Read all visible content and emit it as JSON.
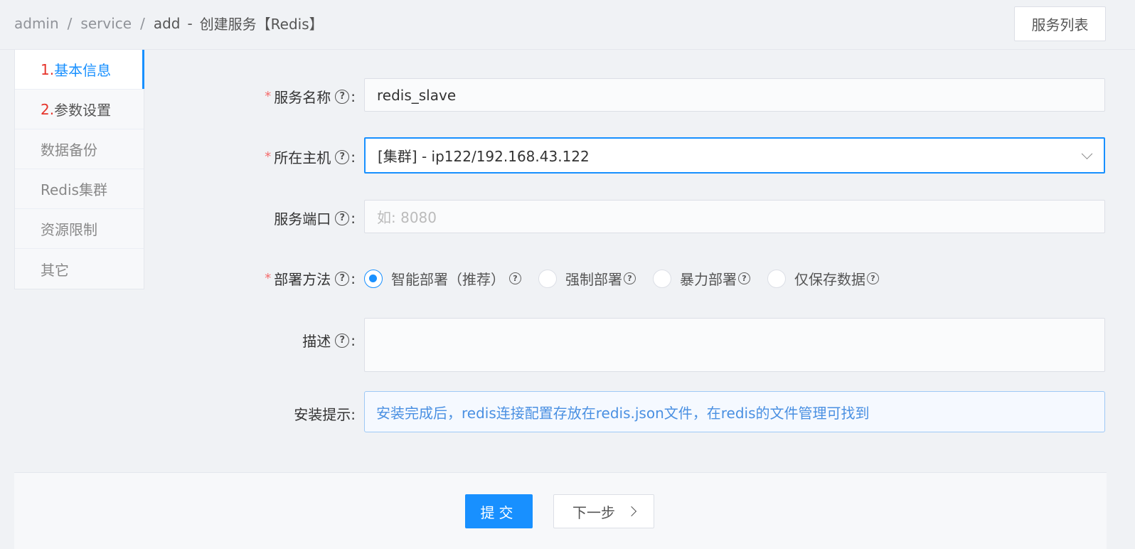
{
  "breadcrumb": {
    "items": [
      "admin",
      "service",
      "add"
    ],
    "separator": "/",
    "dash": "-",
    "page_title": "创建服务【Redis】"
  },
  "header": {
    "service_list_button": "服务列表"
  },
  "sidenav": {
    "items": [
      {
        "num": "1.",
        "label": "基本信息"
      },
      {
        "num": "2.",
        "label": "参数设置"
      },
      {
        "label": "数据备份"
      },
      {
        "label": "Redis集群"
      },
      {
        "label": "资源限制"
      },
      {
        "label": "其它"
      }
    ]
  },
  "form": {
    "required_mark": "*",
    "help_glyph": "?",
    "colon": ":",
    "service_name": {
      "label": "服务名称",
      "value": "redis_slave"
    },
    "host": {
      "label": "所在主机",
      "value": "[集群] - ip122/192.168.43.122"
    },
    "port": {
      "label": "服务端口",
      "placeholder": "如: 8080"
    },
    "deploy": {
      "label": "部署方法",
      "options": [
        "智能部署（推荐）",
        "强制部署",
        "暴力部署",
        "仅保存数据"
      ],
      "selected": "智能部署（推荐）"
    },
    "description": {
      "label": "描述",
      "value": ""
    },
    "install_hint": {
      "label": "安装提示:",
      "text": "安装完成后，redis连接配置存放在redis.json文件，在redis的文件管理可找到"
    }
  },
  "footer": {
    "submit": "提交",
    "next": "下一步"
  },
  "colors": {
    "accent": "#1890ff",
    "required": "#f56c6c",
    "step_number": "#e6332a"
  }
}
